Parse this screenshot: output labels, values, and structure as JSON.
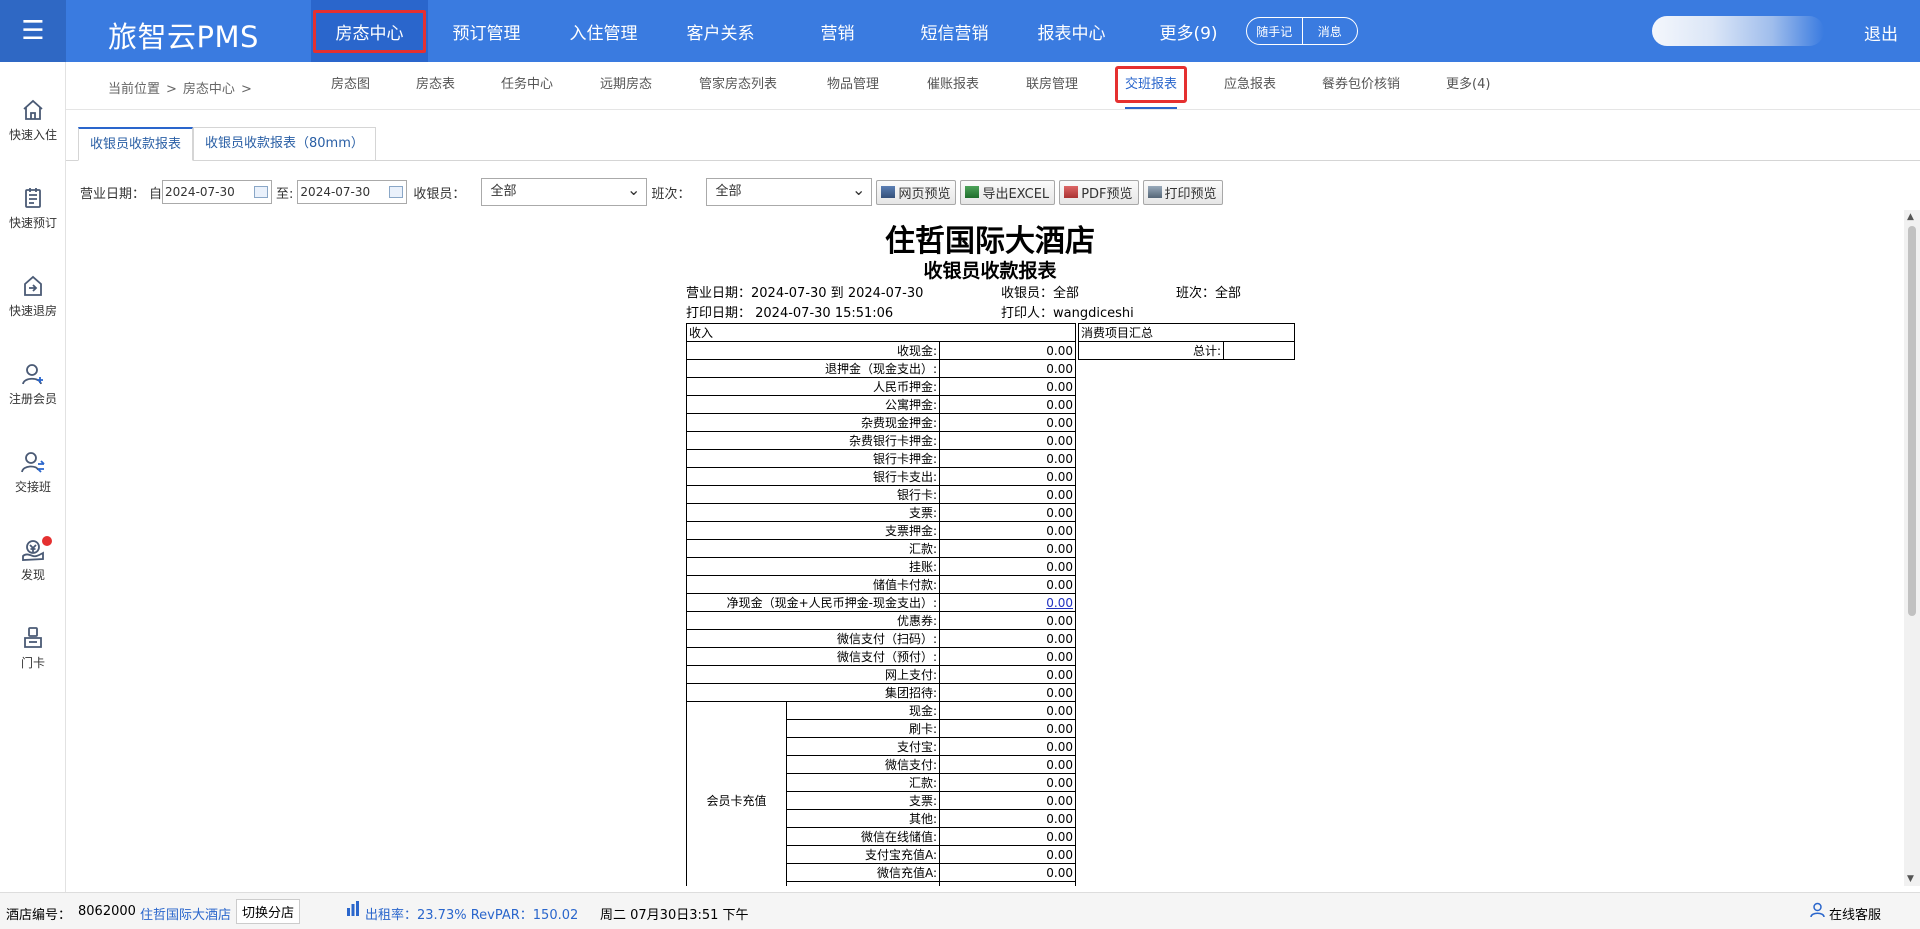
{
  "app": {
    "brand": "旅智云PMS",
    "logout": "退出"
  },
  "topnav": [
    "房态中心",
    "预订管理",
    "入住管理",
    "客户关系",
    "营销",
    "短信营销",
    "报表中心",
    "更多(9)"
  ],
  "topnav_active": "房态中心",
  "pill": {
    "note": "随手记",
    "message": "消息"
  },
  "sidebar": [
    {
      "label": "快速入住",
      "icon": "home-icon"
    },
    {
      "label": "快速预订",
      "icon": "booking-icon"
    },
    {
      "label": "快速退房",
      "icon": "checkout-icon"
    },
    {
      "label": "注册会员",
      "icon": "user-add-icon"
    },
    {
      "label": "交接班",
      "icon": "user-swap-icon"
    },
    {
      "label": "发现",
      "icon": "discover-icon"
    },
    {
      "label": "门卡",
      "icon": "card-icon"
    }
  ],
  "breadcrumb": {
    "prefix": "当前位置",
    "sep": ">",
    "item": "房态中心",
    "sep2": ">"
  },
  "subnav": [
    "房态图",
    "房态表",
    "任务中心",
    "远期房态",
    "管家房态列表",
    "物品管理",
    "催账报表",
    "联房管理",
    "交班报表",
    "应急报表",
    "餐券包价核销",
    "更多(4)"
  ],
  "subnav_active": "交班报表",
  "tabs": [
    "收银员收款报表",
    "收银员收款报表（80mm）"
  ],
  "filters": {
    "date_label": "营业日期：",
    "from_label": "自",
    "from": "2024-07-30",
    "to_label": "至:",
    "to": "2024-07-30",
    "cashier_label": "收银员：",
    "cashier": "全部",
    "shift_label": "班次：",
    "shift": "全部",
    "btn_web": "网页预览",
    "btn_excel": "导出EXCEL",
    "btn_pdf": "PDF预览",
    "btn_print": "打印预览"
  },
  "report": {
    "hotel": "住哲国际大酒店",
    "title": "收银员收款报表",
    "biz_date": "营业日期：2024-07-30 到 2024-07-30",
    "cashier": "收银员：全部",
    "shift": "班次：全部",
    "print_date": "打印日期：  2024-07-30 15:51:06",
    "printer": "打印人：wangdiceshi",
    "income_header": "收入",
    "rows": [
      [
        "收现金:",
        "0.00"
      ],
      [
        "退押金（现金支出）:",
        "0.00"
      ],
      [
        "人民币押金:",
        "0.00"
      ],
      [
        "公寓押金:",
        "0.00"
      ],
      [
        "杂费现金押金:",
        "0.00"
      ],
      [
        "杂费银行卡押金:",
        "0.00"
      ],
      [
        "银行卡押金:",
        "0.00"
      ],
      [
        "银行卡支出:",
        "0.00"
      ],
      [
        "银行卡:",
        "0.00"
      ],
      [
        "支票:",
        "0.00"
      ],
      [
        "支票押金:",
        "0.00"
      ],
      [
        "汇款:",
        "0.00"
      ],
      [
        "挂账:",
        "0.00"
      ],
      [
        "储值卡付款:",
        "0.00"
      ],
      [
        "净现金（现金+人民币押金-现金支出）:",
        "0.00"
      ],
      [
        "优惠券:",
        "0.00"
      ],
      [
        "微信支付（扫码）:",
        "0.00"
      ],
      [
        "微信支付（预付）:",
        "0.00"
      ],
      [
        "网上支付:",
        "0.00"
      ],
      [
        "集团招待:",
        "0.00"
      ]
    ],
    "member_group": "会员卡充值",
    "member_rows": [
      [
        "现金:",
        "0.00"
      ],
      [
        "刷卡:",
        "0.00"
      ],
      [
        "支付宝:",
        "0.00"
      ],
      [
        "微信支付:",
        "0.00"
      ],
      [
        "汇款:",
        "0.00"
      ],
      [
        "支票:",
        "0.00"
      ],
      [
        "其他:",
        "0.00"
      ],
      [
        "微信在线储值:",
        "0.00"
      ],
      [
        "支付宝充值A:",
        "0.00"
      ],
      [
        "微信充值A:",
        "0.00"
      ]
    ],
    "consume_header": "消费项目汇总",
    "consume_total": "总计:"
  },
  "footer": {
    "hotel_no_label": "酒店编号：",
    "hotel_no": "8062000",
    "hotel_name": "住哲国际大酒店",
    "switch": "切换分店",
    "occupancy": "出租率：23.73% RevPAR：150.02",
    "datetime": "周二 07月30日3:51 下午",
    "service": "在线客服"
  },
  "colors": {
    "primary": "#3a7be0",
    "highlight": "#e53030",
    "link": "#2a66cc"
  }
}
